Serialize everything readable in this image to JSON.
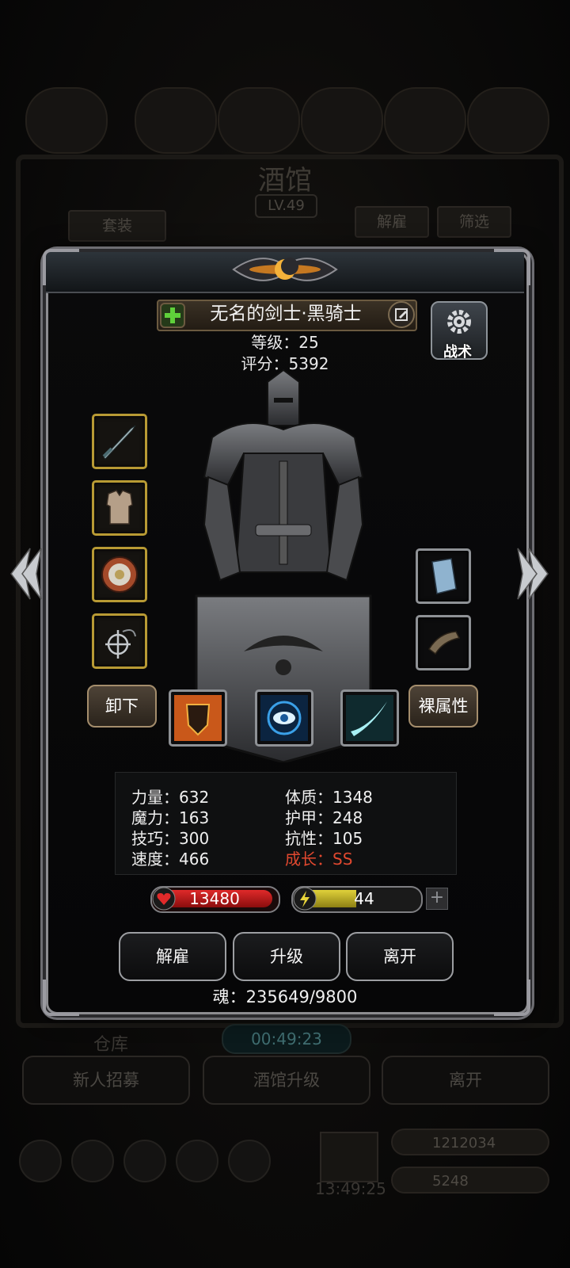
{
  "background": {
    "title": "酒馆",
    "level": "LV.49",
    "set_label": "套装",
    "dismiss_label": "解雇",
    "filter_label": "筛选",
    "timer": "00:49:23",
    "bottom_buttons": [
      "新人招募",
      "酒馆升级",
      "离开"
    ],
    "bottom_clock": "13:49:25",
    "gold": "1212034",
    "gems": "5248",
    "warehouse": "仓库"
  },
  "hero": {
    "name": "无名的剑士·黑骑士",
    "level_text": "等级：25",
    "score_text": "评分：5392",
    "tactics_label": "战术"
  },
  "equipment": {
    "left_icons": [
      "sword-icon",
      "chest-armor-icon",
      "shield-ring-icon",
      "amulet-icon"
    ],
    "right_icons": [
      "book-icon",
      "bracer-icon"
    ]
  },
  "actions": {
    "unequip_label": "卸下",
    "base_attr_label": "裸属性",
    "skills": [
      "flame-shield-skill-icon",
      "eye-skill-icon",
      "slash-skill-icon"
    ]
  },
  "stats": {
    "strength": "力量：632",
    "magic": "魔力：163",
    "skill": "技巧：300",
    "speed": "速度：466",
    "constitution": "体质：1348",
    "armor": "护甲：248",
    "resistance": "抗性：105",
    "growth": "成长：SS"
  },
  "bars": {
    "hp": "13480",
    "energy": "44",
    "energy_fraction": 0.4
  },
  "buttons": {
    "dismiss": "解雇",
    "upgrade": "升级",
    "leave": "离开"
  },
  "soul_text": "魂：235649/9800",
  "colors": {
    "gold_border": "#b89a34",
    "hp_red": "#c01a1a",
    "energy_yellow": "#d4c42c",
    "growth_red": "#e0482f"
  }
}
